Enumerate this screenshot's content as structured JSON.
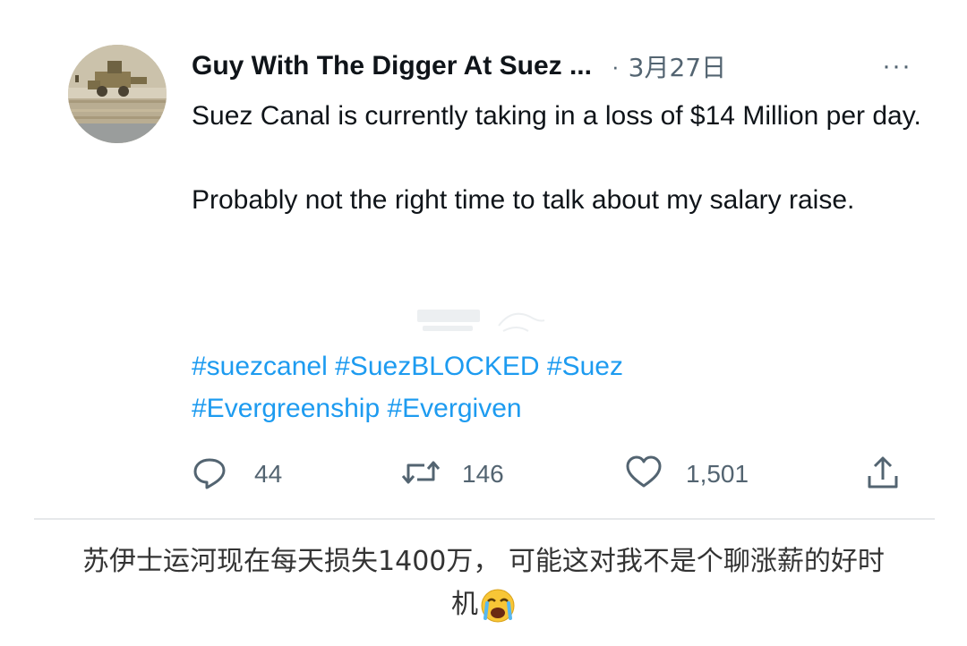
{
  "tweet": {
    "author_name": "Guy With The Digger At Suez ...",
    "separator": "·",
    "timestamp": "3月27日",
    "more_label": "···",
    "text_paragraphs": [
      "Suez Canal is currently taking in a loss of $14 Million per day.",
      "Probably not the right time to talk about my salary raise."
    ],
    "hashtags": [
      "#suezcanel",
      "#SuezBLOCKED",
      "#Suez",
      "#Evergreenship",
      "#Evergiven"
    ],
    "actions": {
      "reply_count": "44",
      "retweet_count": "146",
      "like_count": "1,501"
    }
  },
  "caption": {
    "line1": "苏伊士运河现在每天损失1400万， 可能这对我不是个聊涨薪的好时",
    "line2": "机"
  },
  "colors": {
    "link": "#1d9bf0",
    "muted": "#536471",
    "text": "#0f1419"
  },
  "icons": [
    "reply-icon",
    "retweet-icon",
    "like-icon",
    "share-icon",
    "crying-emoji-icon"
  ]
}
